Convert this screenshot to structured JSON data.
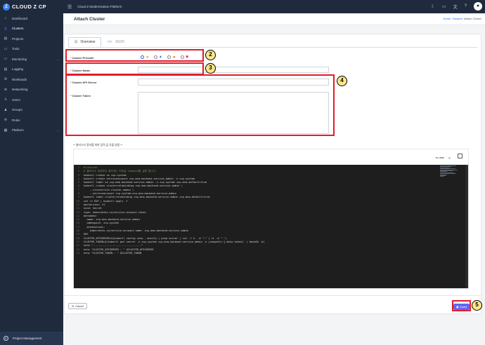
{
  "app": {
    "brand": "CLOUD Z CP",
    "platform_title": "Cloud Z Modernization Platform"
  },
  "sidebar": {
    "items": [
      {
        "label": "Dashboard",
        "icon": "dashboard-icon",
        "glyph": "⌂"
      },
      {
        "label": "Clusters",
        "icon": "clusters-icon",
        "glyph": "◎",
        "active": true
      },
      {
        "label": "Projects",
        "icon": "projects-icon",
        "glyph": "▤"
      },
      {
        "label": "Tools",
        "icon": "tools-icon",
        "glyph": "▭"
      },
      {
        "label": "Monitoring",
        "icon": "monitoring-icon",
        "glyph": "▭",
        "expandable": true
      },
      {
        "label": "Logging",
        "icon": "logging-icon",
        "glyph": "▤"
      },
      {
        "label": "Workloads",
        "icon": "workloads-icon",
        "glyph": "⚙"
      },
      {
        "label": "Networking",
        "icon": "networking-icon",
        "glyph": "⊕"
      },
      {
        "label": "Users",
        "icon": "users-icon",
        "glyph": "♙"
      },
      {
        "label": "Groups",
        "icon": "groups-icon",
        "glyph": "♟"
      },
      {
        "label": "Roles",
        "icon": "roles-icon",
        "glyph": "⊛"
      },
      {
        "label": "Platform",
        "icon": "platform-icon",
        "glyph": "▦",
        "expandable": true
      }
    ],
    "bottom_label": "Project Management"
  },
  "header": {
    "title": "Attach Cluster",
    "breadcrumb": [
      "Home",
      "Clusters",
      "Attach Cluster"
    ]
  },
  "tabs": {
    "overview": "Overview",
    "json": "JSON"
  },
  "form": {
    "provider_label": "Cluster Provider",
    "name_label": "Cluster Name",
    "api_label": "Cluster API Server",
    "token_label": "Cluster Token",
    "required_mark": "*"
  },
  "annotations": [
    "2",
    "3",
    "4",
    "5"
  ],
  "note": "** 클러스터 정보를 위한 입력 값 추출 방법 **",
  "code": {
    "theme": "vs-dark",
    "lines": [
      "#!/bin/sh",
      "# 클러스터 생성하여 접속하는 터미널 Command를 실행 합니다.",
      "kubectl create ns zcp-system",
      "kubectl create serviceaccount zcp-mcm-backend-service-admin -n zcp-system",
      "kubectl label sa zcp-mcm-backend-service-admin -n zcp-system zcp-mcm-default=true",
      "kubectl create clusterrolebinding zcp-mcm-backend-service-admin \\",
      "    --clusterrole cluster-admin \\",
      "    --serviceaccount zcp-system:zcp-mcm-backend-service-admin",
      "kubectl label clusterrolebinding zcp-mcm-backend-service-admin zcp-mcm-default=true",
      "cat << EOF | kubectl apply -f -",
      "apiVersion: v1",
      "kind: Secret",
      "type: kubernetes.io/service-account-token",
      "metadata:",
      "  name: zcp-mcm-backend-service-admin",
      "  namespace: zcp-system",
      "  annotations:",
      "    kubernetes.io/service-account.name: zcp-mcm-backend-service-admin",
      "EOF",
      "CLUSTER_APISERVER=$(kubectl config view --minify | grep server | cut -f 2- -d \":\" | tr -d \" \")",
      "CLUSTER_TOKEN=$(kubectl get secret -n zcp-system zcp-mcm-backend-service-admin -o jsonpath='{.data.token}' | base64 -d)",
      "echo \"--------------------------------\"",
      "echo \"CLUSTER_APISERVER : \" $CLUSTER_APISERVER",
      "echo \"CLUSTER_TOKEN : \" $CLUSTER_TOKEN"
    ]
  },
  "buttons": {
    "cancel": "Cancel",
    "insert": "Insert"
  },
  "colors": {
    "accent": "#6366f1",
    "highlight": "#e11d2a",
    "sidebar_bg": "#1f2a3d"
  }
}
